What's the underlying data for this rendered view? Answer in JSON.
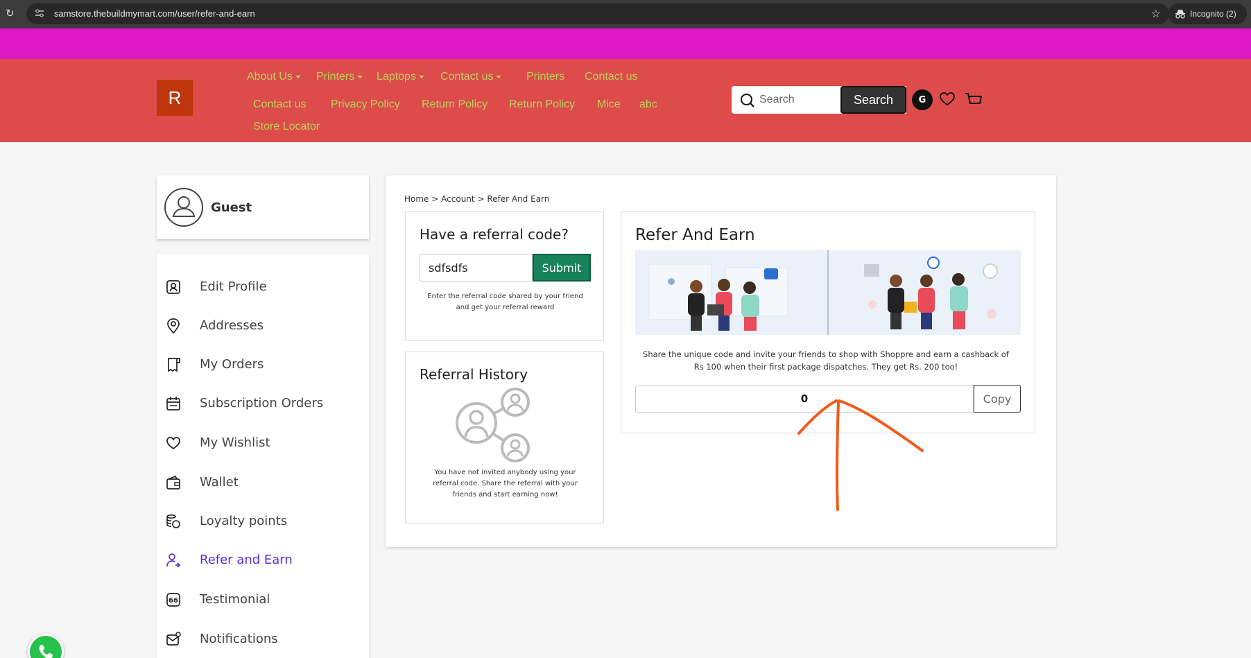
{
  "browser": {
    "url": "samstore.thebuildmymart.com/user/refer-and-earn",
    "incognito_label": "Incognito (2)"
  },
  "header": {
    "logo_letter": "R",
    "nav_row1": [
      {
        "label": "About Us",
        "dropdown": true
      },
      {
        "label": "Printers",
        "dropdown": true
      },
      {
        "label": "Laptops",
        "dropdown": true
      },
      {
        "label": "Contact us",
        "dropdown": true
      },
      {
        "label": "Printers",
        "dropdown": false
      },
      {
        "label": "Contact us",
        "dropdown": false
      }
    ],
    "nav_row2": [
      "Contact us",
      "Privacy Policy",
      "Return Policy",
      "Return Policy",
      "Mice",
      "abc"
    ],
    "nav_row3": [
      "Store Locator"
    ],
    "search_placeholder": "Search",
    "search_button": "Search",
    "account_initial": "G",
    "colors": {
      "top_band": "#dd18c2",
      "header_bg": "#dd4b4b",
      "nav_link": "#b9d35a"
    }
  },
  "sidebar": {
    "user_name": "Guest",
    "items": [
      {
        "label": "Edit Profile",
        "icon": "user-square-icon",
        "active": false
      },
      {
        "label": "Addresses",
        "icon": "location-pin-icon",
        "active": false
      },
      {
        "label": "My Orders",
        "icon": "orders-icon",
        "active": false
      },
      {
        "label": "Subscription Orders",
        "icon": "calendar-icon",
        "active": false
      },
      {
        "label": "My Wishlist",
        "icon": "heart-icon",
        "active": false
      },
      {
        "label": "Wallet",
        "icon": "wallet-icon",
        "active": false
      },
      {
        "label": "Loyalty points",
        "icon": "coins-icon",
        "active": false
      },
      {
        "label": "Refer and Earn",
        "icon": "refer-user-icon",
        "active": true
      },
      {
        "label": "Testimonial",
        "icon": "quote-icon",
        "active": false
      },
      {
        "label": "Notifications",
        "icon": "mail-bell-icon",
        "active": false
      }
    ]
  },
  "breadcrumb": {
    "home": "Home",
    "sep": ">",
    "account": "Account",
    "current": "Refer And Earn"
  },
  "referral_code": {
    "title": "Have a referral code?",
    "input_value": "sdfsdfs",
    "submit_label": "Submit",
    "note_line1": "Enter the referral code shared by your friend",
    "note_line2": "and get your referral reward"
  },
  "referral_history": {
    "title": "Referral History",
    "empty_line1": "You have not invited anybody using your",
    "empty_line2": "referral code. Share the referral with your",
    "empty_line3": "friends and start earning now!"
  },
  "refer_earn": {
    "title": "Refer And Earn",
    "share_line1": "Share the unique code and invite your friends to shop with Shoppre and earn a cashback of",
    "share_line2": "Rs 100 when their first package dispatches. They get Rs. 200 too!",
    "code_value": "0",
    "copy_label": "Copy"
  }
}
